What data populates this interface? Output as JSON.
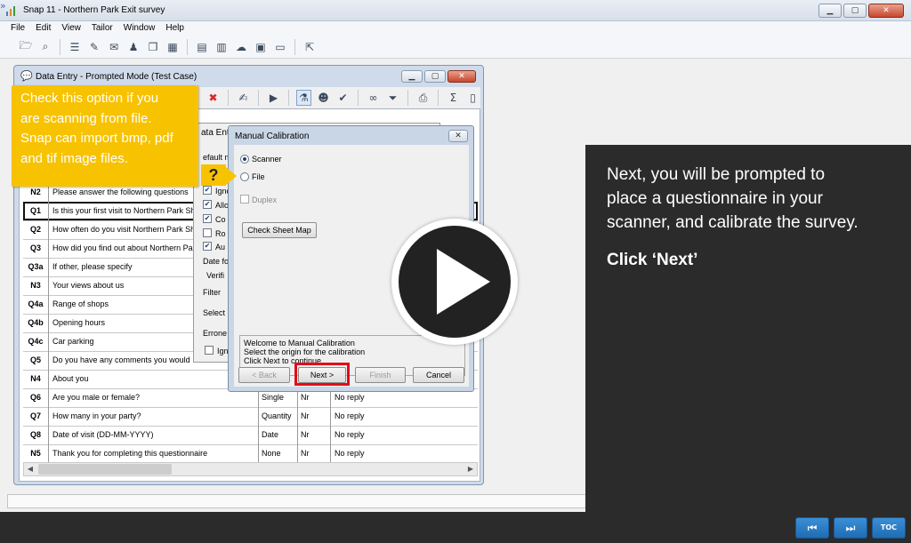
{
  "app": {
    "title": "Snap 11 - Northern Park Exit survey",
    "menu": [
      "File",
      "Edit",
      "View",
      "Tailor",
      "Window",
      "Help"
    ]
  },
  "data_entry": {
    "title": "Data Entry - Prompted Mode (Test Case)"
  },
  "settings_dialog": {
    "header_fragment": "ata Entr",
    "default_label": "efault m",
    "checkbox_labels": [
      "Igno",
      "Allo",
      "Co",
      "Ro",
      "Au"
    ],
    "date_label": "Date fo",
    "verify_label": "Verifi",
    "filter_label": "Filter",
    "select_label": "Select",
    "erroneous_label": "Errone",
    "ignore_label": "Igno"
  },
  "calibration": {
    "title": "Manual Calibration",
    "close_label": "✕",
    "scanner_label": "Scanner",
    "file_label": "File",
    "duplex_label": "Duplex",
    "check_sheet_map_label": "Check Sheet Map",
    "message_lines": [
      "Welcome to Manual Calibration",
      "Select the origin for the calibration",
      "Click Next to continue"
    ],
    "back_label": "< Back",
    "next_label": "Next >",
    "finish_label": "Finish",
    "cancel_label": "Cancel"
  },
  "questions": [
    {
      "id": "N2",
      "text": "Please answer the following questions",
      "type": "",
      "nr": "",
      "reply": ""
    },
    {
      "id": "Q1",
      "text": "Is this your first visit to Northern Park Sh",
      "type": "",
      "nr": "",
      "reply": ""
    },
    {
      "id": "Q2",
      "text": "How often do you visit Northern Park Shop",
      "type": "",
      "nr": "",
      "reply": ""
    },
    {
      "id": "Q3",
      "text": "How did you find out about Northern Park",
      "type": "",
      "nr": "",
      "reply": ""
    },
    {
      "id": "Q3a",
      "text": "If other, please specify",
      "type": "",
      "nr": "",
      "reply": ""
    },
    {
      "id": "N3",
      "text": "Your views about us",
      "type": "",
      "nr": "",
      "reply": ""
    },
    {
      "id": "Q4a",
      "text": "Range of shops",
      "type": "",
      "nr": "",
      "reply": ""
    },
    {
      "id": "Q4b",
      "text": "Opening hours",
      "type": "",
      "nr": "",
      "reply": ""
    },
    {
      "id": "Q4c",
      "text": "Car parking",
      "type": "",
      "nr": "",
      "reply": ""
    },
    {
      "id": "Q5",
      "text": "Do you have any comments you would",
      "type": "",
      "nr": "",
      "reply": ""
    },
    {
      "id": "N4",
      "text": "About you",
      "type": "",
      "nr": "",
      "reply": ""
    },
    {
      "id": "Q6",
      "text": "Are you male or female?",
      "type": "Single",
      "nr": "Nr",
      "reply": "No reply"
    },
    {
      "id": "Q7",
      "text": "How many in your party?",
      "type": "Quantity",
      "nr": "Nr",
      "reply": "No reply"
    },
    {
      "id": "Q8",
      "text": "Date of visit (DD-MM-YYYY)",
      "type": "Date",
      "nr": "Nr",
      "reply": "No reply"
    },
    {
      "id": "N5",
      "text": "Thank you for completing this questionnaire",
      "type": "None",
      "nr": "Nr",
      "reply": "No reply"
    }
  ],
  "tooltip": {
    "text_lines": [
      "Check this option if you",
      "are scanning from file.",
      "Snap can import bmp, pdf",
      "and tif image files."
    ],
    "question_mark": "?"
  },
  "narration": {
    "lines": [
      "Next, you will be prompted to",
      "place a questionnaire in your",
      "scanner, and calibrate the survey."
    ],
    "cta": "Click ‘Next’"
  },
  "player": {
    "prev_label": "⏮",
    "next_label": "⏭",
    "toc_label": "TOC"
  },
  "colors": {
    "tooltip": "#f7c200",
    "highlight": "#e30b17",
    "player_button": "#1f6cb3"
  }
}
